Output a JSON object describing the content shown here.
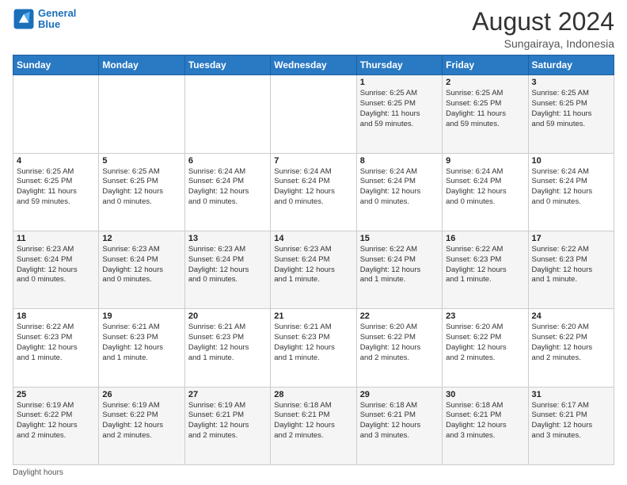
{
  "logo": {
    "line1": "General",
    "line2": "Blue"
  },
  "header": {
    "month_year": "August 2024",
    "location": "Sungairaya, Indonesia"
  },
  "days_of_week": [
    "Sunday",
    "Monday",
    "Tuesday",
    "Wednesday",
    "Thursday",
    "Friday",
    "Saturday"
  ],
  "weeks": [
    [
      {
        "day": "",
        "info": ""
      },
      {
        "day": "",
        "info": ""
      },
      {
        "day": "",
        "info": ""
      },
      {
        "day": "",
        "info": ""
      },
      {
        "day": "1",
        "info": "Sunrise: 6:25 AM\nSunset: 6:25 PM\nDaylight: 11 hours\nand 59 minutes."
      },
      {
        "day": "2",
        "info": "Sunrise: 6:25 AM\nSunset: 6:25 PM\nDaylight: 11 hours\nand 59 minutes."
      },
      {
        "day": "3",
        "info": "Sunrise: 6:25 AM\nSunset: 6:25 PM\nDaylight: 11 hours\nand 59 minutes."
      }
    ],
    [
      {
        "day": "4",
        "info": "Sunrise: 6:25 AM\nSunset: 6:25 PM\nDaylight: 11 hours\nand 59 minutes."
      },
      {
        "day": "5",
        "info": "Sunrise: 6:25 AM\nSunset: 6:25 PM\nDaylight: 12 hours\nand 0 minutes."
      },
      {
        "day": "6",
        "info": "Sunrise: 6:24 AM\nSunset: 6:24 PM\nDaylight: 12 hours\nand 0 minutes."
      },
      {
        "day": "7",
        "info": "Sunrise: 6:24 AM\nSunset: 6:24 PM\nDaylight: 12 hours\nand 0 minutes."
      },
      {
        "day": "8",
        "info": "Sunrise: 6:24 AM\nSunset: 6:24 PM\nDaylight: 12 hours\nand 0 minutes."
      },
      {
        "day": "9",
        "info": "Sunrise: 6:24 AM\nSunset: 6:24 PM\nDaylight: 12 hours\nand 0 minutes."
      },
      {
        "day": "10",
        "info": "Sunrise: 6:24 AM\nSunset: 6:24 PM\nDaylight: 12 hours\nand 0 minutes."
      }
    ],
    [
      {
        "day": "11",
        "info": "Sunrise: 6:23 AM\nSunset: 6:24 PM\nDaylight: 12 hours\nand 0 minutes."
      },
      {
        "day": "12",
        "info": "Sunrise: 6:23 AM\nSunset: 6:24 PM\nDaylight: 12 hours\nand 0 minutes."
      },
      {
        "day": "13",
        "info": "Sunrise: 6:23 AM\nSunset: 6:24 PM\nDaylight: 12 hours\nand 0 minutes."
      },
      {
        "day": "14",
        "info": "Sunrise: 6:23 AM\nSunset: 6:24 PM\nDaylight: 12 hours\nand 1 minute."
      },
      {
        "day": "15",
        "info": "Sunrise: 6:22 AM\nSunset: 6:24 PM\nDaylight: 12 hours\nand 1 minute."
      },
      {
        "day": "16",
        "info": "Sunrise: 6:22 AM\nSunset: 6:23 PM\nDaylight: 12 hours\nand 1 minute."
      },
      {
        "day": "17",
        "info": "Sunrise: 6:22 AM\nSunset: 6:23 PM\nDaylight: 12 hours\nand 1 minute."
      }
    ],
    [
      {
        "day": "18",
        "info": "Sunrise: 6:22 AM\nSunset: 6:23 PM\nDaylight: 12 hours\nand 1 minute."
      },
      {
        "day": "19",
        "info": "Sunrise: 6:21 AM\nSunset: 6:23 PM\nDaylight: 12 hours\nand 1 minute."
      },
      {
        "day": "20",
        "info": "Sunrise: 6:21 AM\nSunset: 6:23 PM\nDaylight: 12 hours\nand 1 minute."
      },
      {
        "day": "21",
        "info": "Sunrise: 6:21 AM\nSunset: 6:23 PM\nDaylight: 12 hours\nand 1 minute."
      },
      {
        "day": "22",
        "info": "Sunrise: 6:20 AM\nSunset: 6:22 PM\nDaylight: 12 hours\nand 2 minutes."
      },
      {
        "day": "23",
        "info": "Sunrise: 6:20 AM\nSunset: 6:22 PM\nDaylight: 12 hours\nand 2 minutes."
      },
      {
        "day": "24",
        "info": "Sunrise: 6:20 AM\nSunset: 6:22 PM\nDaylight: 12 hours\nand 2 minutes."
      }
    ],
    [
      {
        "day": "25",
        "info": "Sunrise: 6:19 AM\nSunset: 6:22 PM\nDaylight: 12 hours\nand 2 minutes."
      },
      {
        "day": "26",
        "info": "Sunrise: 6:19 AM\nSunset: 6:22 PM\nDaylight: 12 hours\nand 2 minutes."
      },
      {
        "day": "27",
        "info": "Sunrise: 6:19 AM\nSunset: 6:21 PM\nDaylight: 12 hours\nand 2 minutes."
      },
      {
        "day": "28",
        "info": "Sunrise: 6:18 AM\nSunset: 6:21 PM\nDaylight: 12 hours\nand 2 minutes."
      },
      {
        "day": "29",
        "info": "Sunrise: 6:18 AM\nSunset: 6:21 PM\nDaylight: 12 hours\nand 3 minutes."
      },
      {
        "day": "30",
        "info": "Sunrise: 6:18 AM\nSunset: 6:21 PM\nDaylight: 12 hours\nand 3 minutes."
      },
      {
        "day": "31",
        "info": "Sunrise: 6:17 AM\nSunset: 6:21 PM\nDaylight: 12 hours\nand 3 minutes."
      }
    ]
  ],
  "footer": {
    "note": "Daylight hours"
  }
}
